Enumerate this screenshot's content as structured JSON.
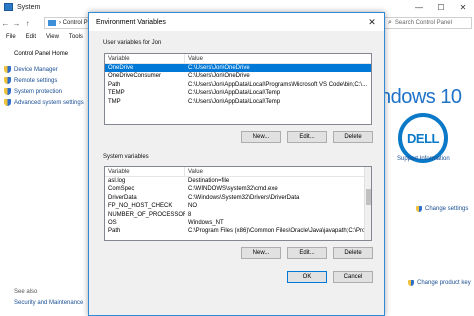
{
  "system_window": {
    "title": "System",
    "caption": {
      "minimize": "—",
      "maximize": "☐",
      "close": "✕"
    },
    "nav": {
      "back": "←",
      "forward": "→",
      "up": "↑"
    },
    "address": "› Control P",
    "search_placeholder": "Search Control Panel",
    "menu": [
      "File",
      "Edit",
      "View",
      "Tools"
    ],
    "home": "Control Panel Home",
    "left_nav": [
      "Device Manager",
      "Remote settings",
      "System protection",
      "Advanced system settings"
    ],
    "see_also": "See also",
    "security_maintenance": "Security and Maintenance",
    "windows_logo_text": "indows 10",
    "dell_logo": "DELL",
    "support_info": "Support Information",
    "change_settings": "Change settings",
    "change_product_key": "Change product key"
  },
  "dialog": {
    "title": "Environment Variables",
    "close": "✕",
    "user_group_label": "User variables for Jon",
    "user_columns": [
      "Variable",
      "Value"
    ],
    "user_vars": [
      {
        "name": "OneDrive",
        "value": "C:\\Users\\Jon\\OneDrive",
        "selected": true
      },
      {
        "name": "OneDriveConsumer",
        "value": "C:\\Users\\Jon\\OneDrive",
        "selected": false
      },
      {
        "name": "Path",
        "value": "C:\\Users\\Jon\\AppData\\Local\\Programs\\Microsoft VS Code\\bin;C:\\...",
        "selected": false
      },
      {
        "name": "TEMP",
        "value": "C:\\Users\\Jon\\AppData\\Local\\Temp",
        "selected": false
      },
      {
        "name": "TMP",
        "value": "C:\\Users\\Jon\\AppData\\Local\\Temp",
        "selected": false
      }
    ],
    "user_buttons": {
      "new": "New...",
      "edit": "Edit...",
      "delete": "Delete"
    },
    "system_group_label": "System variables",
    "system_columns": [
      "Variable",
      "Value"
    ],
    "system_vars": [
      {
        "name": "asl.log",
        "value": "Destination=file"
      },
      {
        "name": "ComSpec",
        "value": "C:\\WINDOWS\\system32\\cmd.exe"
      },
      {
        "name": "DriverData",
        "value": "C:\\Windows\\System32\\Drivers\\DriverData"
      },
      {
        "name": "FP_NO_HOST_CHECK",
        "value": "NO"
      },
      {
        "name": "NUMBER_OF_PROCESSORS",
        "value": "8"
      },
      {
        "name": "OS",
        "value": "Windows_NT"
      },
      {
        "name": "Path",
        "value": "C:\\Program Files (x86)\\Common Files\\Oracle\\Java\\javapath;C:\\Pro..."
      }
    ],
    "system_buttons": {
      "new": "New...",
      "edit": "Edit...",
      "delete": "Delete"
    },
    "ok": "OK",
    "cancel": "Cancel"
  },
  "colors": {
    "selection": "#0078d7",
    "link": "#1a4f94",
    "dell_blue": "#0a79c8"
  }
}
